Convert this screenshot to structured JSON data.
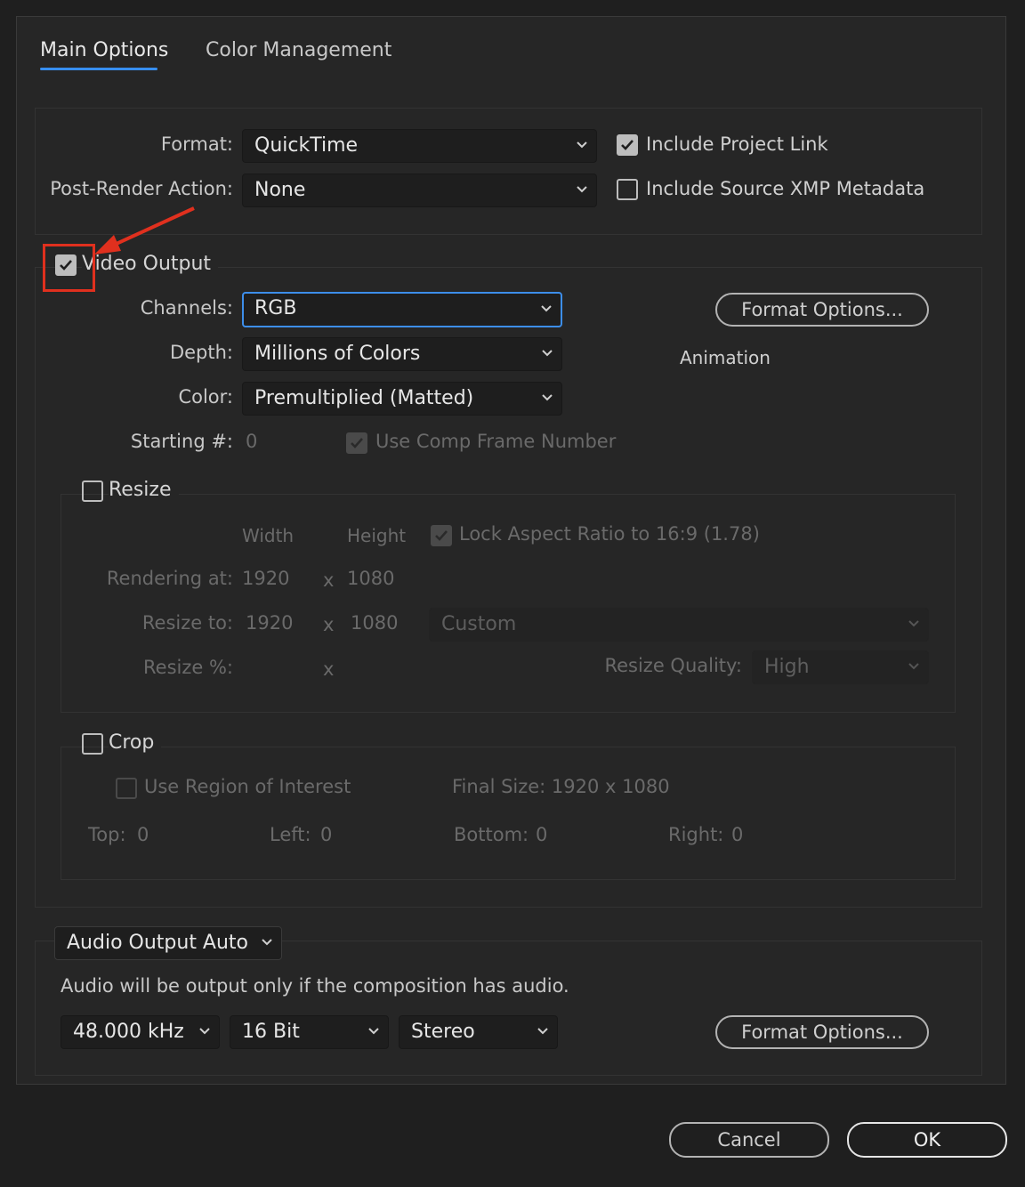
{
  "tabs": [
    {
      "label": "Main Options"
    },
    {
      "label": "Color Management"
    }
  ],
  "format": {
    "format_label": "Format:",
    "format_value": "QuickTime",
    "post_render_label": "Post-Render Action:",
    "post_render_value": "None",
    "include_project_link": "Include Project Link",
    "include_xmp": "Include Source XMP Metadata"
  },
  "video": {
    "title": "Video Output",
    "channels_label": "Channels:",
    "channels_value": "RGB",
    "depth_label": "Depth:",
    "depth_value": "Millions of Colors",
    "color_label": "Color:",
    "color_value": "Premultiplied (Matted)",
    "starting_label": "Starting #:",
    "starting_value": "0",
    "use_comp_frame": "Use Comp Frame Number",
    "format_options_button": "Format Options...",
    "codec": "Animation"
  },
  "resize": {
    "title": "Resize",
    "width_header": "Width",
    "height_header": "Height",
    "lock_aspect": "Lock Aspect Ratio to 16:9 (1.78)",
    "rendering_at_label": "Rendering at:",
    "rendering_width": "1920",
    "rendering_height": "1080",
    "resize_to_label": "Resize to:",
    "resize_width": "1920",
    "resize_height": "1080",
    "preset_value": "Custom",
    "resize_pct_label": "Resize %:",
    "x_symbol": "x",
    "quality_label": "Resize Quality:",
    "quality_value": "High"
  },
  "crop": {
    "title": "Crop",
    "use_roi": "Use Region of Interest",
    "final_size": "Final Size: 1920 x 1080",
    "top_label": "Top:",
    "top_value": "0",
    "left_label": "Left:",
    "left_value": "0",
    "bottom_label": "Bottom:",
    "bottom_value": "0",
    "right_label": "Right:",
    "right_value": "0"
  },
  "audio": {
    "mode_value": "Audio Output Auto",
    "note": "Audio will be output only if the composition has audio.",
    "rate_value": "48.000 kHz",
    "bits_value": "16 Bit",
    "channels_value": "Stereo",
    "format_options_button": "Format Options..."
  },
  "footer": {
    "cancel": "Cancel",
    "ok": "OK"
  },
  "colors": {
    "accent": "#378ef0",
    "annotation": "#e0301e"
  }
}
